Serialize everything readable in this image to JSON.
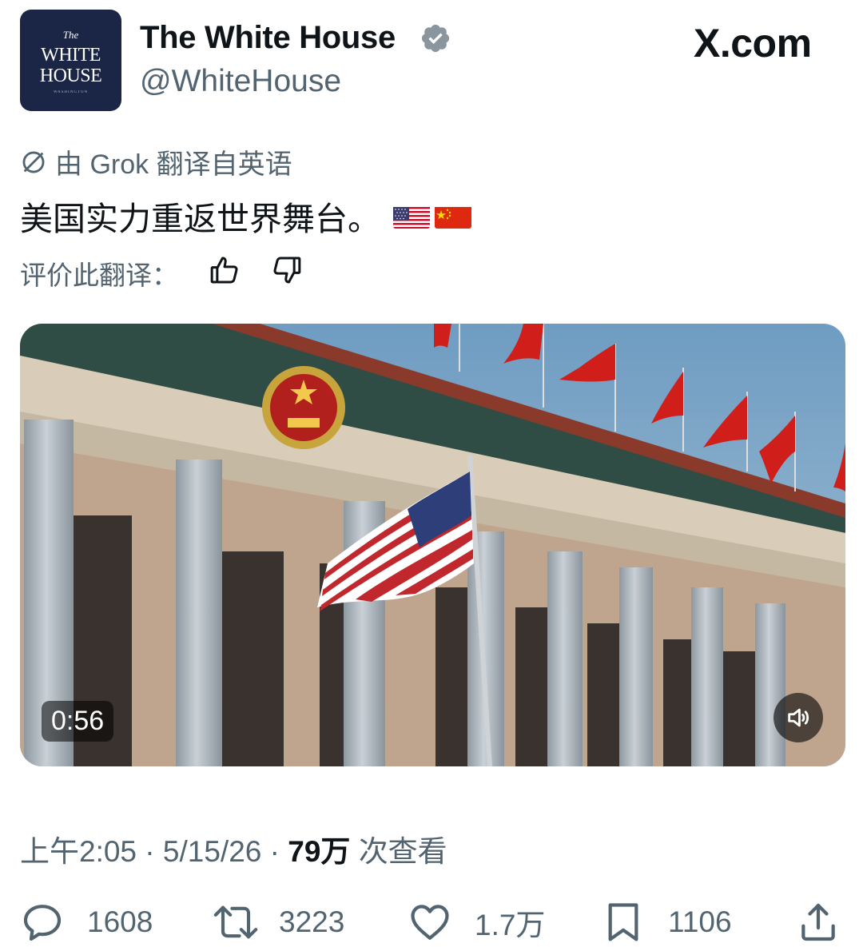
{
  "account": {
    "avatar_text": [
      "The",
      "WHITE",
      "HOUSE",
      "WASHINGTON"
    ],
    "name": "The White House",
    "handle": "@WhiteHouse",
    "verified_icon": "verified-badge-icon"
  },
  "site_logo": "X.com",
  "translation": {
    "notice": "由 Grok 翻译自英语",
    "text": "美国实力重返世界舞台。",
    "emojis": [
      "us-flag-emoji",
      "china-flag-emoji"
    ],
    "rate_label": "评价此翻译："
  },
  "video": {
    "duration": "0:56",
    "description": "Great Hall of the People with US flag"
  },
  "meta": {
    "time": "上午2:05",
    "date": "5/15/26",
    "views": "79万",
    "views_label": "次查看",
    "sep": "·"
  },
  "actions": {
    "replies": "1608",
    "reposts": "3223",
    "likes": "1.7万",
    "bookmarks": "1106"
  },
  "colors": {
    "avatar_bg": "#1b2545",
    "verified": "#8a959e",
    "muted_text": "#536471"
  }
}
